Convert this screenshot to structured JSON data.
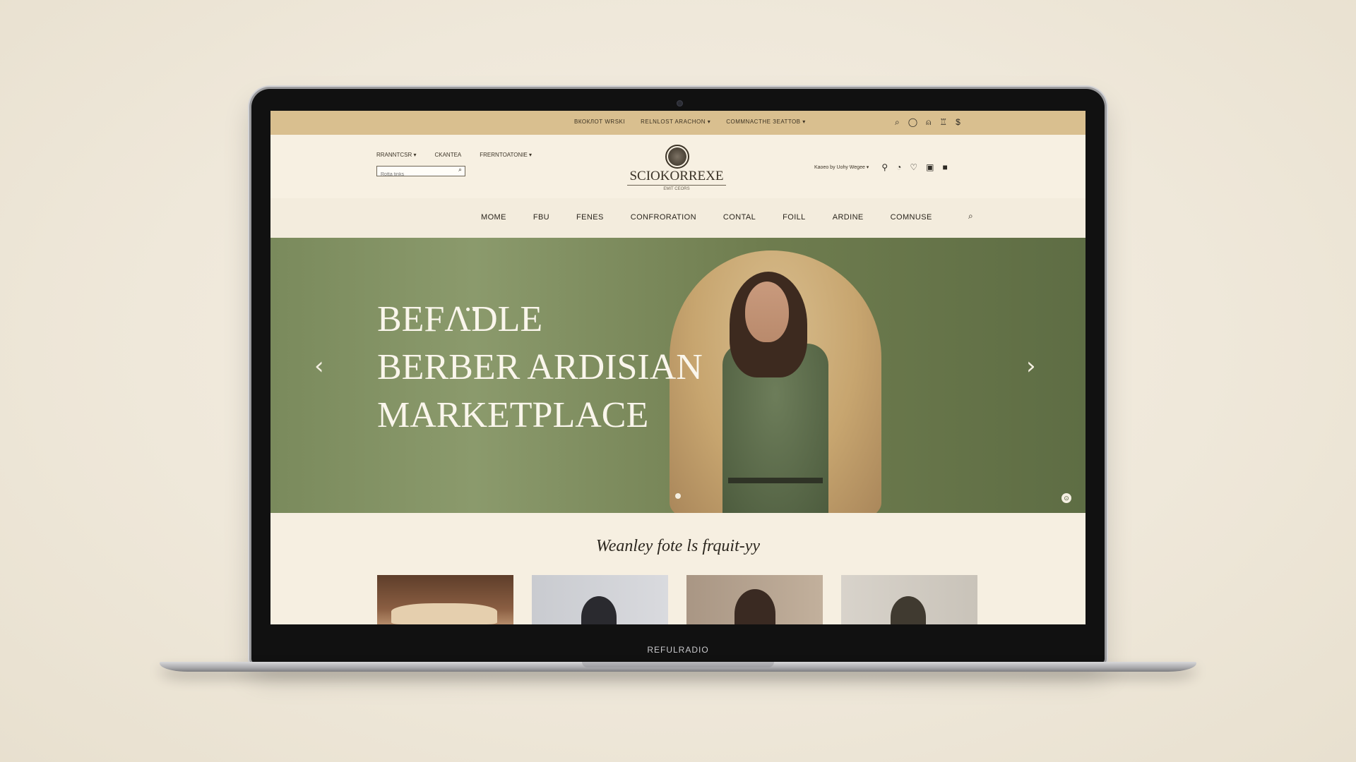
{
  "device": {
    "brand_label": "REFULRADIO"
  },
  "topbar": {
    "links": [
      "ВКОКЛОТ WRSKI",
      "RELNLOST ARACHON ▾",
      "COMMNACTHE ЗЕАТТОВ ▾"
    ],
    "icons": [
      "search-icon",
      "location-icon",
      "bag-icon",
      "user-icon",
      "currency-icon"
    ]
  },
  "header": {
    "links": [
      "RRANNTCSR ▾",
      "CKANTEA",
      "FRERNTOATONIE ▾"
    ],
    "search": {
      "placeholder": "Rotta tinks"
    },
    "logo": {
      "name": "SCIOKORREXE",
      "tagline": "EMIT CEORS"
    },
    "locale": "Kaoeo by Uohy Wegee ▾",
    "icons": [
      "pin-icon",
      "globe-icon",
      "heart-icon",
      "image-icon",
      "cart-icon"
    ]
  },
  "nav": {
    "items": [
      "MOME",
      "FBU",
      "FENES",
      "CONFRORATION",
      "CONTAL",
      "FOILL",
      "ARDINE",
      "COMNUSE"
    ]
  },
  "hero": {
    "lines": [
      "BEFΛ̈DLE",
      "BERBER ARDISIAN",
      "MARKETPLACE"
    ],
    "prev_arrow": "‹",
    "next_arrow": "›",
    "badge": "⊙"
  },
  "featured": {
    "title": "Weanley fote ls frquit-yy",
    "tiles": [
      "tile-1",
      "tile-2",
      "tile-3",
      "tile-4"
    ]
  },
  "colors": {
    "topbar": "#d9bf8f",
    "page_bg": "#f6efe1",
    "hero_green": "#7a8a5c",
    "shawl_tan": "#c7a56f"
  }
}
